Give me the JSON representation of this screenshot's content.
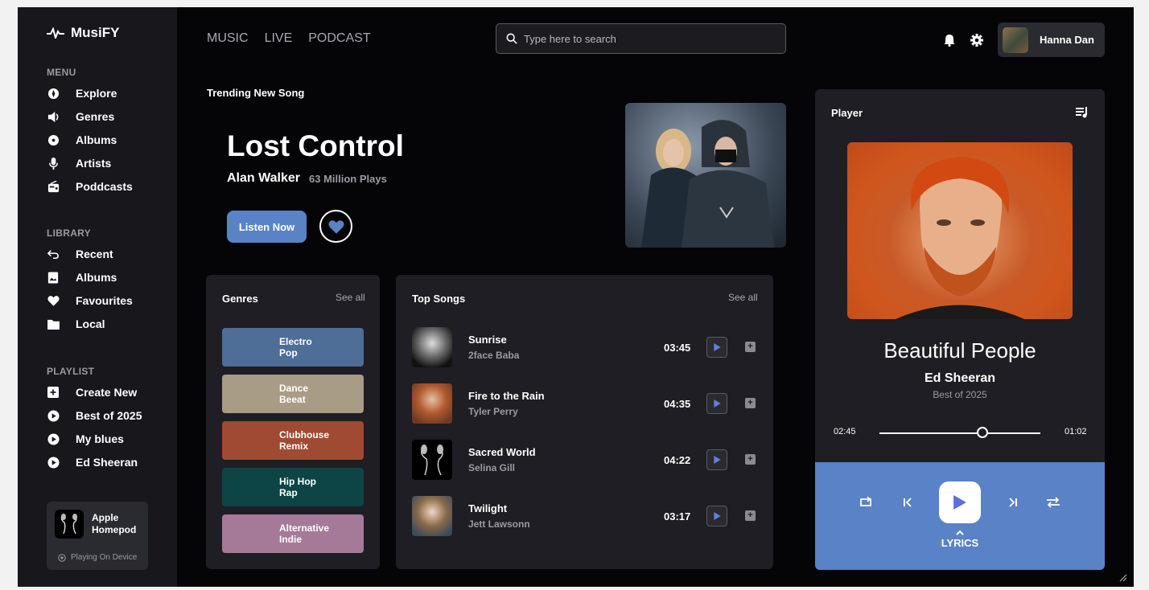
{
  "app": {
    "name": "MusiFY"
  },
  "sidebar": {
    "menu_title": "MENU",
    "menu": [
      {
        "label": "Explore"
      },
      {
        "label": "Genres"
      },
      {
        "label": "Albums"
      },
      {
        "label": "Artists"
      },
      {
        "label": "Poddcasts"
      }
    ],
    "library_title": "LIBRARY",
    "library": [
      {
        "label": "Recent"
      },
      {
        "label": "Albums"
      },
      {
        "label": "Favourites"
      },
      {
        "label": "Local"
      }
    ],
    "playlist_title": "PLAYLIST",
    "playlist": [
      {
        "label": "Create New"
      },
      {
        "label": "Best of 2025"
      },
      {
        "label": "My blues"
      },
      {
        "label": "Ed Sheeran"
      }
    ],
    "device": {
      "name": "Apple Homepod",
      "status": "Playing On Device"
    }
  },
  "header": {
    "tabs": [
      "MUSIC",
      "LIVE",
      "PODCAST"
    ],
    "search_placeholder": "Type here to search",
    "user_name": "Hanna Dan"
  },
  "trending": {
    "label": "Trending New Song",
    "title": "Lost Control",
    "artist": "Alan Walker",
    "plays": "63 Million Plays",
    "listen_label": "Listen Now"
  },
  "genres": {
    "title": "Genres",
    "see_all": "See all",
    "items": [
      {
        "label": "Electro\nPop",
        "color": "#4e6d97"
      },
      {
        "label": "Dance\nBeeat",
        "color": "#a99c86"
      },
      {
        "label": "Clubhouse\nRemix",
        "color": "#a14a33"
      },
      {
        "label": "Hip Hop\nRap",
        "color": "#0d4446"
      },
      {
        "label": "Alternative\nIndie",
        "color": "#a57a98"
      }
    ]
  },
  "top_songs": {
    "title": "Top Songs",
    "see_all": "See all",
    "items": [
      {
        "title": "Sunrise",
        "artist": "2face Baba",
        "duration": "03:45"
      },
      {
        "title": "Fire to the Rain",
        "artist": "Tyler Perry",
        "duration": "04:35"
      },
      {
        "title": "Sacred World",
        "artist": "Selina Gill",
        "duration": "04:22"
      },
      {
        "title": "Twilight",
        "artist": "Jett Lawsonn",
        "duration": "03:17"
      }
    ]
  },
  "player": {
    "title": "Player",
    "track": "Beautiful People",
    "artist": "Ed Sheeran",
    "album": "Best of 2025",
    "elapsed": "02:45",
    "remaining": "01:02",
    "progress": 0.64,
    "lyrics_label": "LYRICS"
  },
  "colors": {
    "accent": "#5a82c6",
    "background": "#050507",
    "panel": "#1e1e24",
    "sidebar": "#17171c"
  }
}
